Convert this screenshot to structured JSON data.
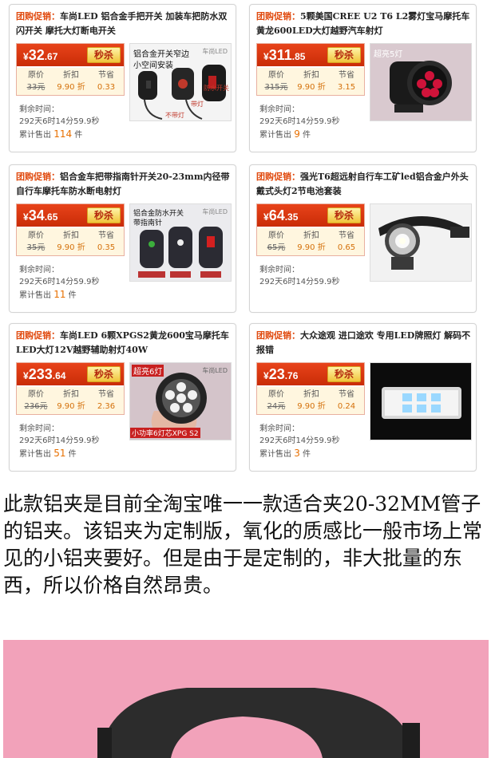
{
  "cards": [
    {
      "promo": "团购促销：",
      "title": "车尚LED 铝合金手把开关 加装车把防水双闪开关 摩托大灯断电开关",
      "price_int": "32",
      "price_dec": ".67",
      "yen": "¥",
      "kill": "秒杀",
      "orig_label": "原价",
      "orig_value": "33元",
      "disc_label": "折扣",
      "disc_value": "9.90 折",
      "save_label": "节省",
      "save_value": "0.33",
      "remain_label": "剩余时间：",
      "remain_value": "292天6时14分59.9秒",
      "sold_label": "累计售出",
      "sold_count": "114",
      "sold_unit": "件",
      "img_text": [
        "铝合金开关窄边",
        "小空间安装",
        "车尚LED",
        "防水开关",
        "带灯",
        "不带灯"
      ]
    },
    {
      "promo": "团购促销：",
      "title": "5颗美国CREE U2 T6 L2雾灯宝马摩托车黄龙600LED大灯越野汽车射灯",
      "price_int": "311",
      "price_dec": ".85",
      "yen": "¥",
      "kill": "秒杀",
      "orig_label": "原价",
      "orig_value": "315元",
      "disc_label": "折扣",
      "disc_value": "9.90 折",
      "save_label": "节省",
      "save_value": "3.15",
      "remain_label": "剩余时间：",
      "remain_value": "292天6时14分59.9秒",
      "sold_label": "累计售出",
      "sold_count": "9",
      "sold_unit": "件",
      "img_text": [
        "超亮5灯"
      ]
    },
    {
      "promo": "团购促销：",
      "title": "铝合金车把带指南针开关20-23mm内径带自行车摩托车防水断电射灯",
      "price_int": "34",
      "price_dec": ".65",
      "yen": "¥",
      "kill": "秒杀",
      "orig_label": "原价",
      "orig_value": "35元",
      "disc_label": "折扣",
      "disc_value": "9.90 折",
      "save_label": "节省",
      "save_value": "0.35",
      "remain_label": "剩余时间：",
      "remain_value": "292天6时14分59.9秒",
      "sold_label": "累计售出",
      "sold_count": "11",
      "sold_unit": "件",
      "img_text": [
        "铝合金防水开关",
        "带指南针",
        "车尚LED"
      ]
    },
    {
      "promo": "团购促销：",
      "title": "强光T6超远射自行车工矿led铝合金户外头戴式头灯2节电池套装",
      "price_int": "64",
      "price_dec": ".35",
      "yen": "¥",
      "kill": "秒杀",
      "orig_label": "原价",
      "orig_value": "65元",
      "disc_label": "折扣",
      "disc_value": "9.90 折",
      "save_label": "节省",
      "save_value": "0.65",
      "remain_label": "剩余时间：",
      "remain_value": "292天6时14分59.9秒",
      "sold_label": "累计售出",
      "sold_count": "",
      "sold_unit": "",
      "img_text": []
    },
    {
      "promo": "团购促销：",
      "title": "车尚LED 6颗XPGS2黄龙600宝马摩托车LED大灯12V越野辅助射灯40W",
      "price_int": "233",
      "price_dec": ".64",
      "yen": "¥",
      "kill": "秒杀",
      "orig_label": "原价",
      "orig_value": "236元",
      "disc_label": "折扣",
      "disc_value": "9.90 折",
      "save_label": "节省",
      "save_value": "2.36",
      "remain_label": "剩余时间：",
      "remain_value": "292天6时14分59.9秒",
      "sold_label": "累计售出",
      "sold_count": "51",
      "sold_unit": "件",
      "img_text": [
        "超亮6灯",
        "车尚LED",
        "小功率6灯芯XPG S2"
      ]
    },
    {
      "promo": "团购促销：",
      "title": "大众途观 进口途欢 专用LED牌照灯 解码不报错",
      "price_int": "23",
      "price_dec": ".76",
      "yen": "¥",
      "kill": "秒杀",
      "orig_label": "原价",
      "orig_value": "24元",
      "disc_label": "折扣",
      "disc_value": "9.90 折",
      "save_label": "节省",
      "save_value": "0.24",
      "remain_label": "剩余时间：",
      "remain_value": "292天6时14分59.9秒",
      "sold_label": "累计售出",
      "sold_count": "3",
      "sold_unit": "件",
      "img_text": []
    }
  ],
  "description": "此款铝夹是目前全淘宝唯一一款适合夹20-32MM管子的铝夹。该铝夹为定制版，氧化的质感比一般市场上常见的小铝夹要好。但是由于是定制的，非大批量的东西，所以价格自然昂贵。",
  "colors": {
    "promo": "#e0480c",
    "price_bar": "#d5360f",
    "kill_text": "#b3260c",
    "count": "#e87000"
  }
}
